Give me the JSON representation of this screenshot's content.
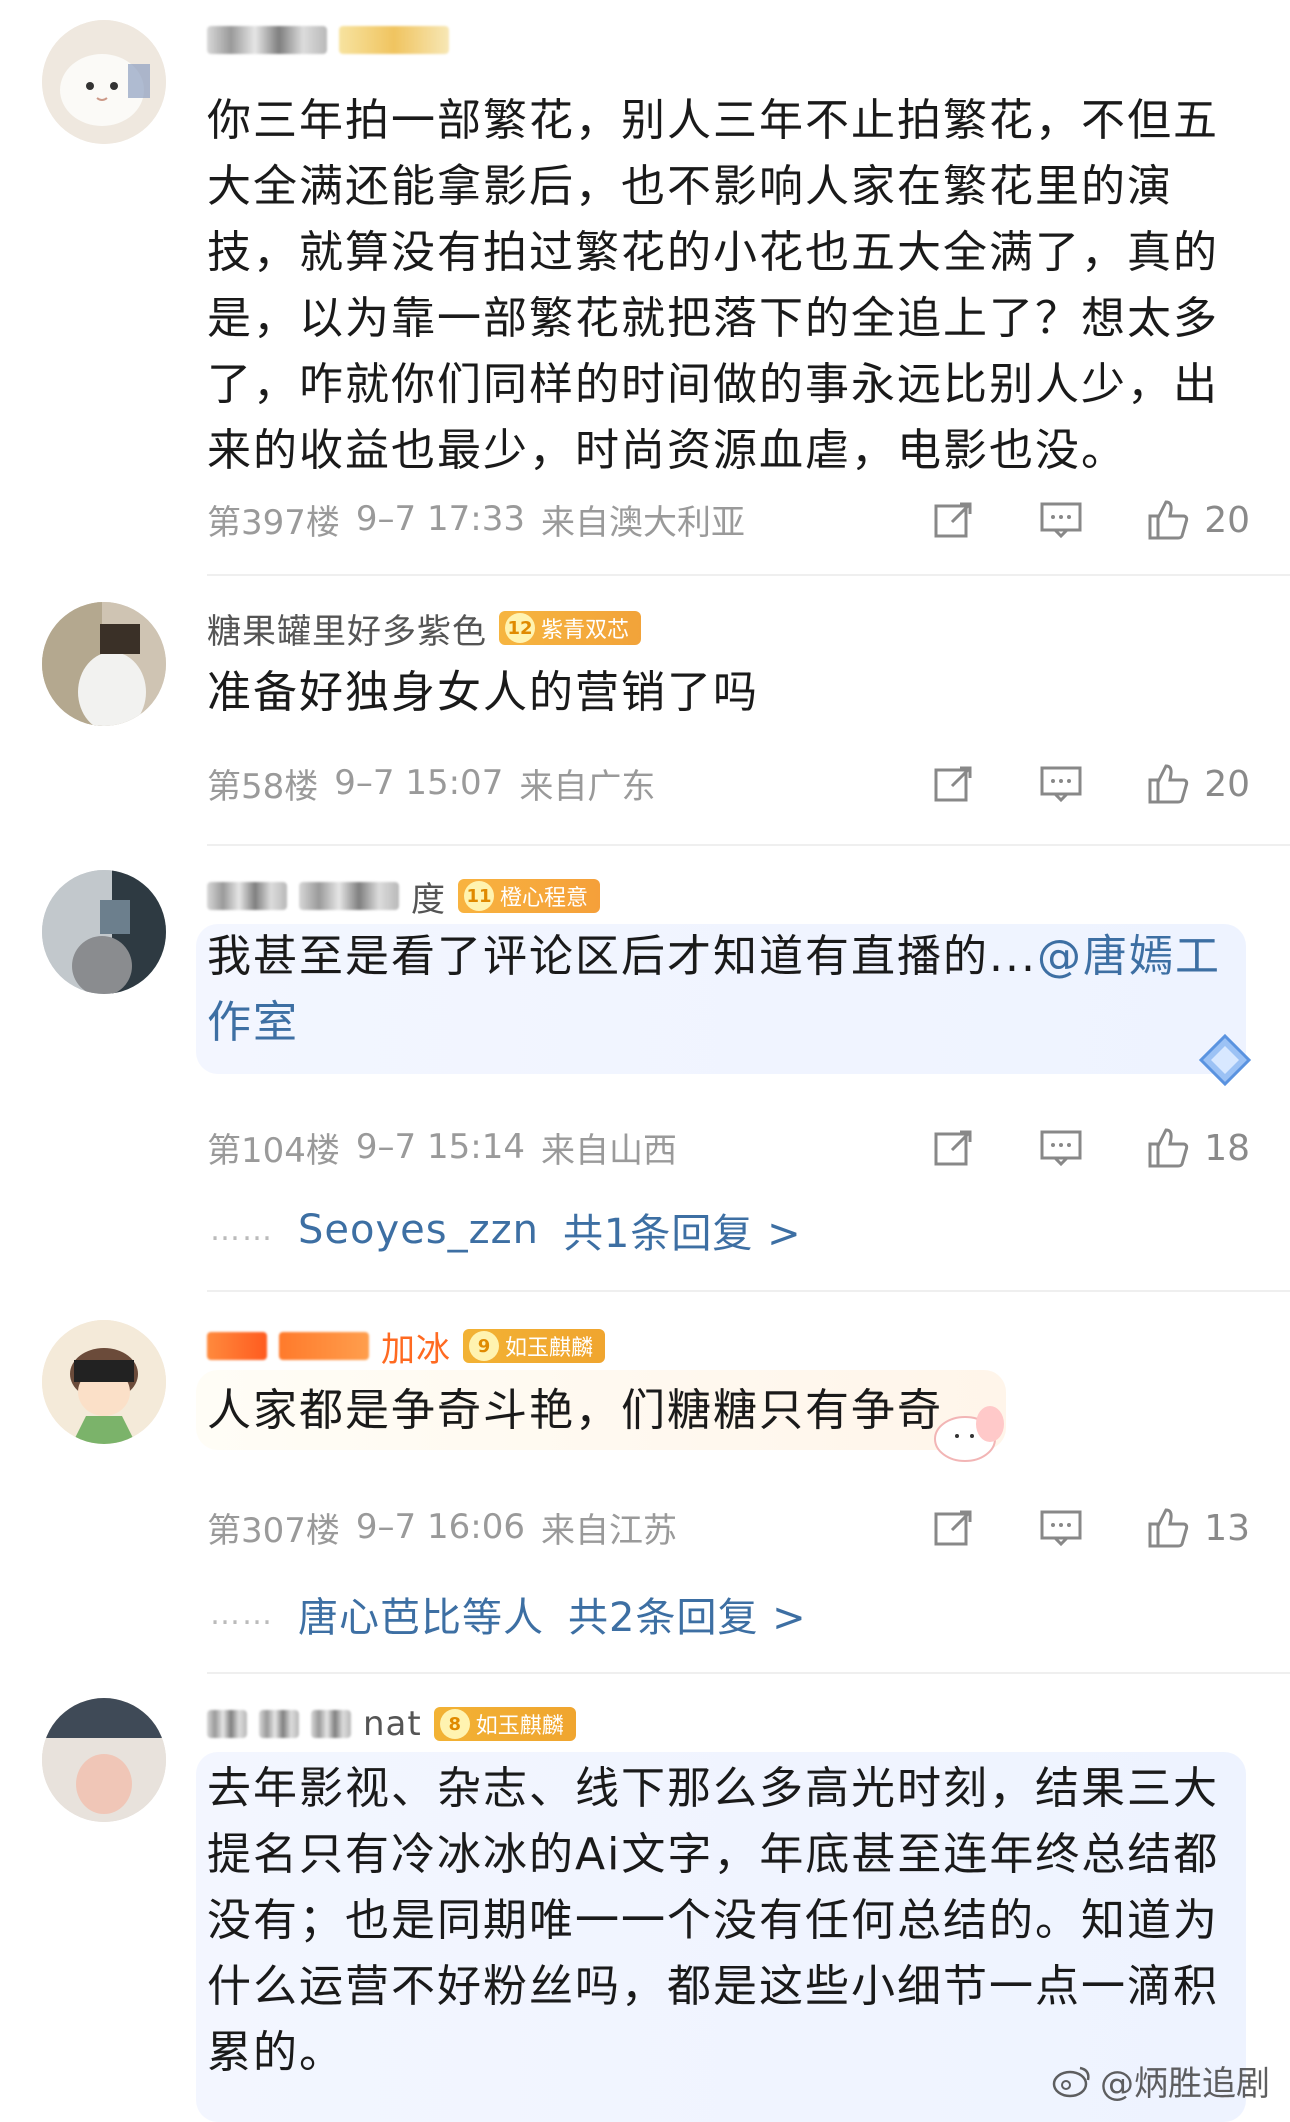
{
  "comments": [
    {
      "text": "你三年拍一部繁花，别人三年不止拍繁花，不但五大全满还能拿影后，也不影响人家在繁花里的演技，就算没有拍过繁花的小花也五大全满了，真的是，以为靠一部繁花就把落下的全追上了？想太多了，咋就你们同样的时间做的事永远比别人少，出来的收益也最少，时尚资源血虐，电影也没。",
      "floor": "第397楼",
      "time": "9–7 17:33",
      "location": "来自澳大利亚",
      "likes": "20"
    },
    {
      "name": "糖果罐里好多紫色",
      "badge_level": "12",
      "badge_label": "紫青双芯",
      "text": "准备好独身女人的营销了吗",
      "floor": "第58楼",
      "time": "9–7 15:07",
      "location": "来自广东",
      "likes": "20"
    },
    {
      "name": "度",
      "badge_level": "11",
      "badge_label": "橙心程意",
      "text": "我甚至是看了评论区后才知道有直播的...",
      "mention": "@唐嫣工作室",
      "floor": "第104楼",
      "time": "9–7 15:14",
      "location": "来自山西",
      "likes": "18",
      "reply_dots": "……",
      "reply_user": "Seoyes_zzn",
      "reply_count": "共1条回复 >"
    },
    {
      "name": "加冰",
      "badge_level": "9",
      "badge_label": "如玉麒麟",
      "text": "人家都是争奇斗艳，们糖糖只有争奇",
      "floor": "第307楼",
      "time": "9–7 16:06",
      "location": "来自江苏",
      "likes": "13",
      "reply_dots": "……",
      "reply_user": "唐心芭比等人",
      "reply_count": "共2条回复 >"
    },
    {
      "name": "nat",
      "badge_level": "8",
      "badge_label": "如玉麒麟",
      "text": "去年影视、杂志、线下那么多高光时刻，结果三大提名只有冷冰冰的Ai文字，年底甚至连年终总结都没有；也是同期唯一一个没有任何总结的。知道为什么运营不好粉丝吗，都是这些小细节一点一滴积累的。"
    }
  ],
  "watermark": "@炳胜追剧",
  "colors": {
    "link": "#3d6fa3",
    "meta": "#9a9a9a",
    "badge_purple": "#f6b540",
    "badge_orange": "#f8b340",
    "badge_gold": "#f2b234"
  }
}
